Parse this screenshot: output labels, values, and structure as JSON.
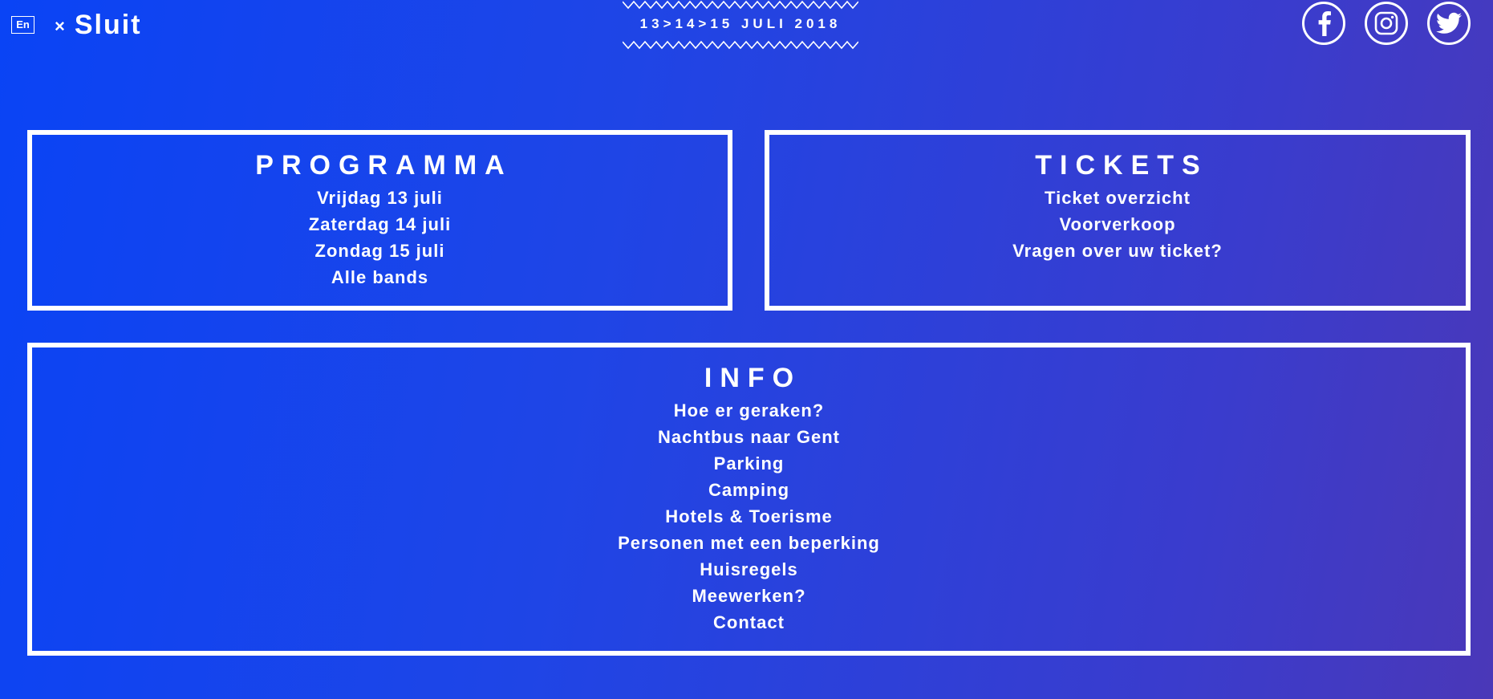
{
  "header": {
    "language_toggle": "En",
    "close_icon": "close-icon",
    "close_label": "Sluit",
    "date_banner": "13>14>15 JULI 2018",
    "socials": [
      {
        "name": "facebook-icon",
        "label": "Facebook"
      },
      {
        "name": "instagram-icon",
        "label": "Instagram"
      },
      {
        "name": "twitter-icon",
        "label": "Twitter"
      }
    ]
  },
  "menu": {
    "programma": {
      "title": "PROGRAMMA",
      "items": [
        "Vrijdag 13 juli",
        "Zaterdag 14 juli",
        "Zondag 15 juli",
        "Alle bands"
      ]
    },
    "tickets": {
      "title": "TICKETS",
      "items": [
        "Ticket overzicht",
        "Voorverkoop",
        "Vragen over uw ticket?"
      ]
    },
    "info": {
      "title": "INFO",
      "items": [
        "Hoe er geraken?",
        "Nachtbus naar Gent",
        "Parking",
        "Camping",
        "Hotels & Toerisme",
        "Personen met een beperking",
        "Huisregels",
        "Meewerken?",
        "Contact"
      ]
    }
  },
  "colors": {
    "background_start": "#0a44f5",
    "background_end": "#4a38b8",
    "foreground": "#ffffff"
  }
}
